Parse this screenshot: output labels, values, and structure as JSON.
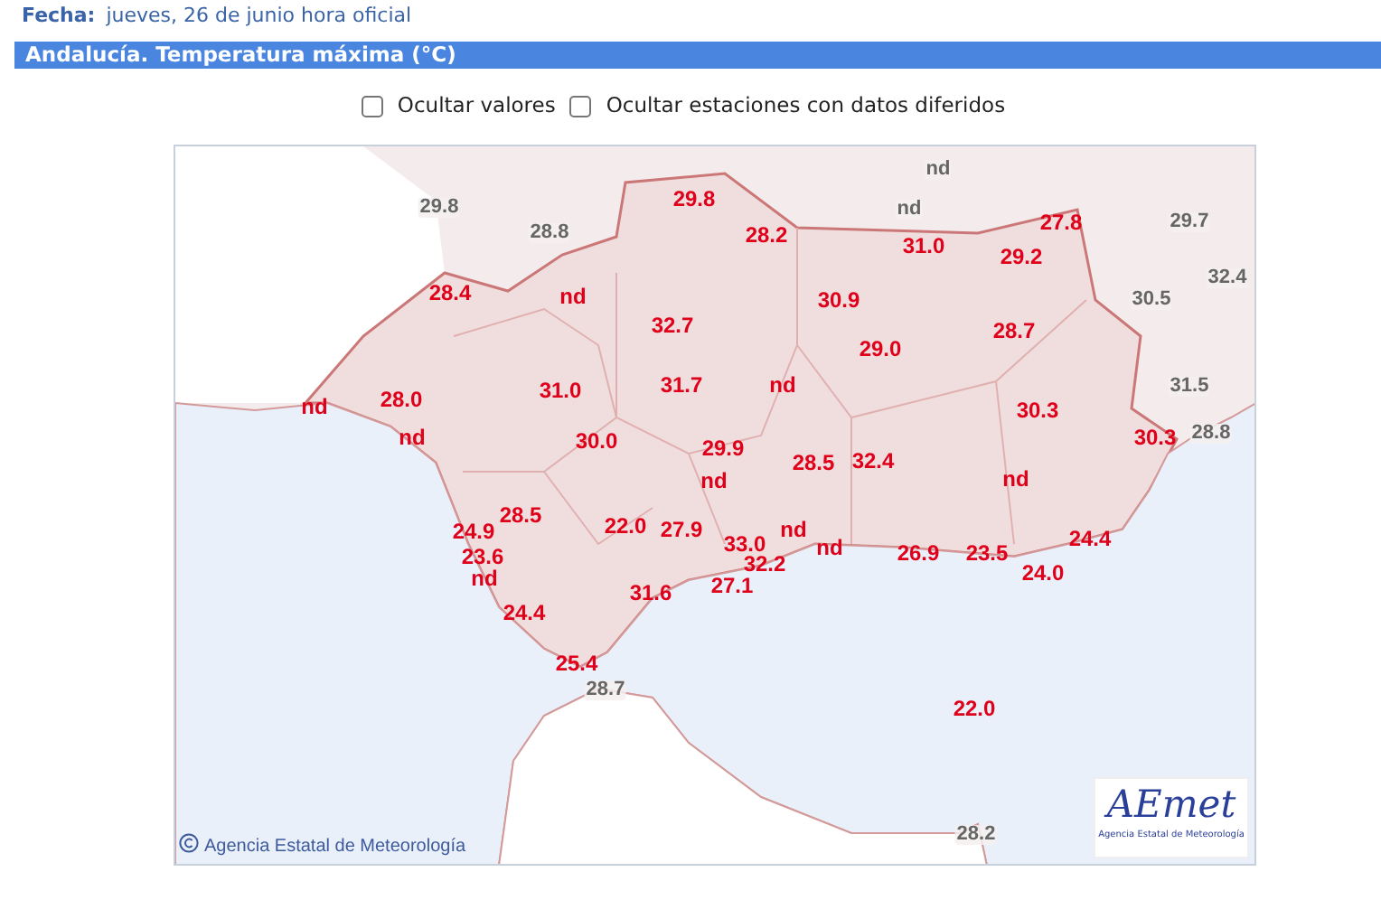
{
  "date": {
    "label": "Fecha:",
    "value": "jueves, 26 de junio hora oficial"
  },
  "title": "Andalucía. Temperatura máxima (°C)",
  "options": [
    {
      "label": "Ocultar valores",
      "checked": false
    },
    {
      "label": "Ocultar estaciones con datos diferidos",
      "checked": false
    }
  ],
  "map": {
    "stations": [
      {
        "value": "nd",
        "kind": "outside"
      },
      {
        "value": "29.8",
        "kind": "outside"
      },
      {
        "value": "29.8",
        "kind": "andalucia"
      },
      {
        "value": "nd",
        "kind": "outside"
      },
      {
        "value": "28.8",
        "kind": "outside"
      },
      {
        "value": "27.8",
        "kind": "andalucia"
      },
      {
        "value": "29.7",
        "kind": "outside"
      },
      {
        "value": "28.2",
        "kind": "andalucia"
      },
      {
        "value": "31.0",
        "kind": "andalucia"
      },
      {
        "value": "29.2",
        "kind": "andalucia"
      },
      {
        "value": "32.4",
        "kind": "outside"
      },
      {
        "value": "28.4",
        "kind": "andalucia"
      },
      {
        "value": "nd",
        "kind": "andalucia"
      },
      {
        "value": "30.9",
        "kind": "andalucia"
      },
      {
        "value": "30.5",
        "kind": "outside"
      },
      {
        "value": "32.7",
        "kind": "andalucia"
      },
      {
        "value": "28.7",
        "kind": "andalucia"
      },
      {
        "value": "29.0",
        "kind": "andalucia"
      },
      {
        "value": "31.0",
        "kind": "andalucia"
      },
      {
        "value": "31.7",
        "kind": "andalucia"
      },
      {
        "value": "nd",
        "kind": "andalucia"
      },
      {
        "value": "31.5",
        "kind": "outside"
      },
      {
        "value": "nd",
        "kind": "andalucia"
      },
      {
        "value": "28.0",
        "kind": "andalucia"
      },
      {
        "value": "30.3",
        "kind": "andalucia"
      },
      {
        "value": "nd",
        "kind": "andalucia"
      },
      {
        "value": "30.0",
        "kind": "andalucia"
      },
      {
        "value": "30.3",
        "kind": "andalucia"
      },
      {
        "value": "28.8",
        "kind": "outside"
      },
      {
        "value": "29.9",
        "kind": "andalucia"
      },
      {
        "value": "28.5",
        "kind": "andalucia"
      },
      {
        "value": "32.4",
        "kind": "andalucia"
      },
      {
        "value": "nd",
        "kind": "andalucia"
      },
      {
        "value": "nd",
        "kind": "andalucia"
      },
      {
        "value": "24.9",
        "kind": "andalucia"
      },
      {
        "value": "23.6",
        "kind": "andalucia"
      },
      {
        "value": "nd",
        "kind": "andalucia"
      },
      {
        "value": "28.5",
        "kind": "andalucia"
      },
      {
        "value": "22.0",
        "kind": "andalucia"
      },
      {
        "value": "31.6",
        "kind": "andalucia"
      },
      {
        "value": "27.9",
        "kind": "andalucia"
      },
      {
        "value": "27.1",
        "kind": "andalucia"
      },
      {
        "value": "33.0",
        "kind": "andalucia"
      },
      {
        "value": "32.2",
        "kind": "andalucia"
      },
      {
        "value": "nd",
        "kind": "andalucia"
      },
      {
        "value": "nd",
        "kind": "andalucia"
      },
      {
        "value": "26.9",
        "kind": "andalucia"
      },
      {
        "value": "23.5",
        "kind": "andalucia"
      },
      {
        "value": "24.0",
        "kind": "andalucia"
      },
      {
        "value": "24.4",
        "kind": "andalucia"
      },
      {
        "value": "24.4",
        "kind": "andalucia"
      },
      {
        "value": "25.4",
        "kind": "andalucia"
      },
      {
        "value": "28.7",
        "kind": "outside"
      },
      {
        "value": "22.0",
        "kind": "andalucia"
      },
      {
        "value": "28.2",
        "kind": "outside"
      }
    ],
    "copyright": "Agencia Estatal de Meteorología",
    "logo": {
      "wordmark": "AEmet",
      "tagline": "Agencia Estatal de Meteorología"
    }
  }
}
